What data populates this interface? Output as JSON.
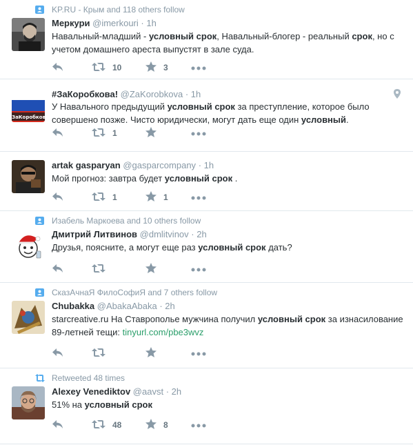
{
  "tweets": [
    {
      "context": "KP.RU - Крым and 118 others follow",
      "context_icon": "follow-icon",
      "fullname": "Меркури",
      "username": "@imerkouri",
      "sep": "·",
      "time": "1h",
      "text_parts": [
        {
          "t": "Навальный-младший - ",
          "b": false
        },
        {
          "t": "условный срок",
          "b": true
        },
        {
          "t": ", Навальный-блогер - реальный ",
          "b": false
        },
        {
          "t": "срок",
          "b": true
        },
        {
          "t": ", но с учетом домашнего ареста выпустят в зале суда.",
          "b": false
        }
      ],
      "retweets": "10",
      "favorites": "3"
    },
    {
      "context": "",
      "fullname": "#ЗаКоробкова!",
      "username": "@ZaKorobkova",
      "sep": "·",
      "time": "1h",
      "avatar_caption": "#ЗаКоробкова",
      "text_parts": [
        {
          "t": "У Навального предыдущий ",
          "b": false
        },
        {
          "t": "условный срок",
          "b": true
        },
        {
          "t": " за преступление, которое было совершено позже. Чисто юридически, могут дать еще один ",
          "b": false
        },
        {
          "t": "условный",
          "b": true
        },
        {
          "t": ".",
          "b": false
        }
      ],
      "retweets": "1",
      "favorites": "",
      "geo_icon": "location-pin-icon"
    },
    {
      "context": "",
      "fullname": "artak gasparyan",
      "username": "@gasparcompany",
      "sep": "·",
      "time": "1h",
      "text_parts": [
        {
          "t": "Мой прогноз: завтра будет ",
          "b": false
        },
        {
          "t": "условный срок",
          "b": true
        },
        {
          "t": " .",
          "b": false
        }
      ],
      "retweets": "1",
      "favorites": "1"
    },
    {
      "context": "Изабель Маркоева and 10 others follow",
      "context_icon": "follow-icon",
      "fullname": "Дмитрий Литвинов",
      "username": "@dmlitvinov",
      "sep": "·",
      "time": "2h",
      "text_parts": [
        {
          "t": "Друзья, поясните, а могут еще раз ",
          "b": false
        },
        {
          "t": "условный срок",
          "b": true
        },
        {
          "t": " дать?",
          "b": false
        }
      ],
      "retweets": "",
      "favorites": ""
    },
    {
      "context": "СказАчнаЯ ФилоСофиЯ and 7 others follow",
      "context_icon": "follow-icon",
      "fullname": "Chubakka",
      "username": "@AbakaAbaka",
      "sep": "·",
      "time": "2h",
      "text_parts": [
        {
          "t": "starcreative.ru На Ставрополье мужчина получил ",
          "b": false
        },
        {
          "t": "условный срок",
          "b": true
        },
        {
          "t": " за изнасилование 89-летней тещи:  ",
          "b": false
        },
        {
          "t": "tinyurl.com/pbe3wvz",
          "b": false,
          "link": true
        }
      ],
      "retweets": "",
      "favorites": ""
    },
    {
      "context": "Retweeted 48 times",
      "context_icon": "retweeted-icon",
      "fullname": "Alexey Venediktov",
      "username": "@aavst",
      "sep": "·",
      "time": "2h",
      "text_parts": [
        {
          "t": "51% на ",
          "b": false
        },
        {
          "t": "условный срок",
          "b": true
        }
      ],
      "retweets": "48",
      "favorites": "8"
    }
  ],
  "colors": {
    "icon": "#8899a6",
    "context_icon": "#55acee",
    "link": "#2a9e6a",
    "border": "#e1e8ed"
  }
}
